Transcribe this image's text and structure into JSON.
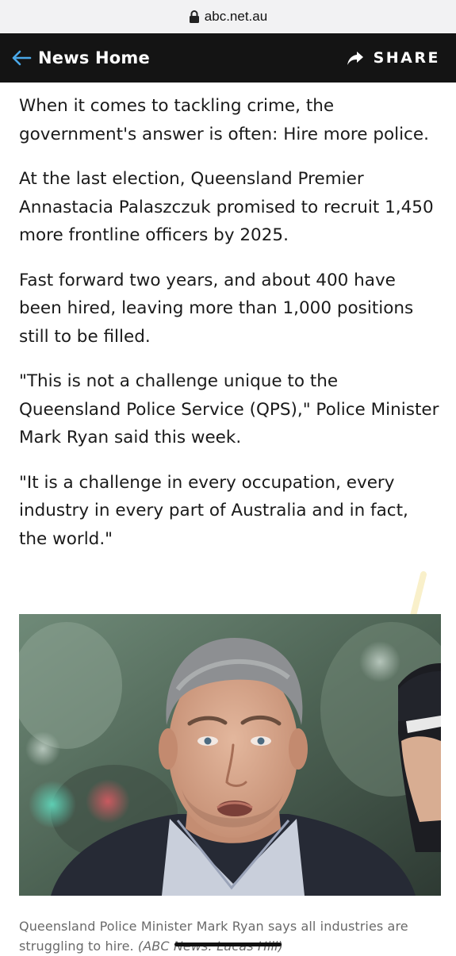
{
  "browser": {
    "url": "abc.net.au"
  },
  "nav": {
    "back_label": "News Home",
    "share_label": "SHARE",
    "background": "#141414",
    "back_arrow_color": "#4aa8e8"
  },
  "article": {
    "paragraphs": [
      "When it comes to tackling crime, the government's answer is often: Hire more police.",
      "At the last election, Queensland Premier Annastacia Palaszczuk promised to recruit 1,450 more frontline officers by 2025.",
      "Fast forward two years, and about 400 have been hired, leaving more than 1,000 positions still to be filled.",
      "\"This is not a challenge unique to the Queensland Police Service (QPS),\" Police Minister Mark Ryan said this week.",
      "\"It is a challenge in every occupation, every industry in every part of Australia and in fact, the world.\""
    ]
  },
  "photo": {
    "caption": "Queensland Police Minister Mark Ryan says all industries are struggling to hire.",
    "credit": "(ABC News: Lucas Hill)"
  },
  "icons": {
    "lock": "lock-icon",
    "back": "back-arrow-icon",
    "share": "share-icon"
  }
}
